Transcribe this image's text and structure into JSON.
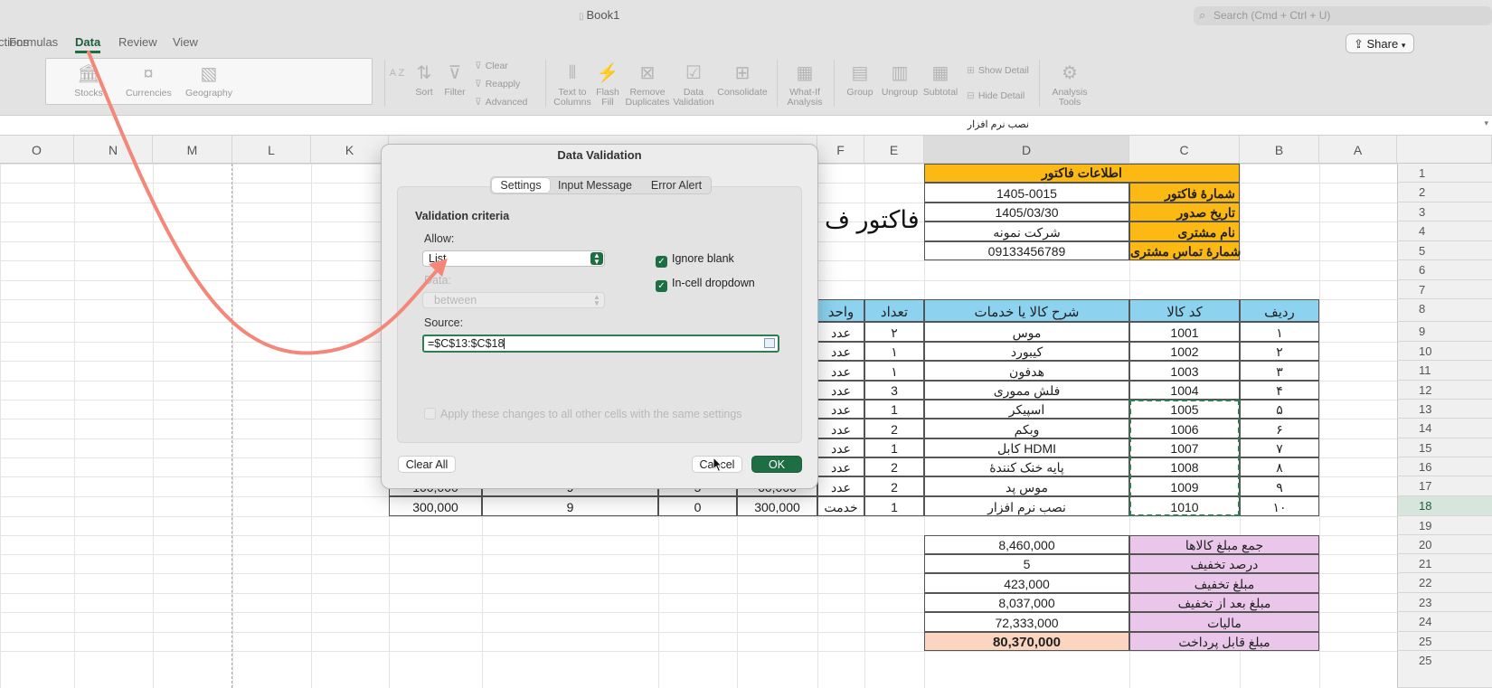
{
  "window": {
    "doc_title": "Book1",
    "search_placeholder": "Search (Cmd + Ctrl + U)",
    "share_label": "Share"
  },
  "menu": {
    "tabs": [
      {
        "label": "ctions"
      },
      {
        "label": "Formulas"
      },
      {
        "label": "Data"
      },
      {
        "label": "Review"
      },
      {
        "label": "View"
      }
    ]
  },
  "ribbon": {
    "data_types": [
      "Stocks",
      "Currencies",
      "Geography"
    ],
    "sort_az": "A Z",
    "sort": "Sort",
    "filter": "Filter",
    "clear": "Clear",
    "reapply": "Reapply",
    "advanced": "Advanced",
    "text_to_columns": [
      "Text to",
      "Columns"
    ],
    "flash_fill": [
      "Flash",
      "Fill"
    ],
    "remove_duplicates": [
      "Remove",
      "Duplicates"
    ],
    "data_validation": [
      "Data",
      "Validation"
    ],
    "consolidate": "Consolidate",
    "what_if": [
      "What-If",
      "Analysis"
    ],
    "group": "Group",
    "ungroup": "Ungroup",
    "subtotal": "Subtotal",
    "show_detail": "Show Detail",
    "hide_detail": "Hide Detail",
    "analysis_tools": [
      "Analysis",
      "Tools"
    ]
  },
  "formula_bar": {
    "content": "نصب نرم افزار"
  },
  "columns": [
    "O",
    "N",
    "M",
    "L",
    "K",
    "F",
    "E",
    "D",
    "C",
    "B",
    "A"
  ],
  "rows": [
    "1",
    "2",
    "3",
    "4",
    "5",
    "6",
    "7",
    "8",
    "9",
    "10",
    "11",
    "12",
    "13",
    "14",
    "15",
    "16",
    "17",
    "18",
    "19",
    "20",
    "21",
    "22",
    "23",
    "24",
    "25"
  ],
  "sheet": {
    "title_fragment": "فاکتور ف",
    "invoice_header": "اطلاعات فاکتور",
    "info": [
      {
        "label": "شمارهٔ فاکتور",
        "value": "1405-0015"
      },
      {
        "label": "تاریخ صدور",
        "value": "1405/03/30"
      },
      {
        "label": "نام مشتری",
        "value": "شرکت نمونه"
      },
      {
        "label": "شمارهٔ تماس مشتری",
        "value": "09133456789"
      }
    ],
    "table_headers": {
      "row_no": "ردیف",
      "code": "کد کالا",
      "desc": "شرح کالا یا خدمات",
      "qty": "تعداد",
      "unit": "واحد"
    },
    "items": [
      {
        "no": "۱",
        "code": "1001",
        "desc": "موس",
        "qty": "۲",
        "unit": "عدد"
      },
      {
        "no": "۲",
        "code": "1002",
        "desc": "کیبورد",
        "qty": "۱",
        "unit": "عدد"
      },
      {
        "no": "۳",
        "code": "1003",
        "desc": "هدفون",
        "qty": "۱",
        "unit": "عدد"
      },
      {
        "no": "۴",
        "code": "1004",
        "desc": "فلش مموری",
        "qty": "3",
        "unit": "عدد"
      },
      {
        "no": "۵",
        "code": "1005",
        "desc": "اسپیکر",
        "qty": "1",
        "unit": "عدد"
      },
      {
        "no": "۶",
        "code": "1006",
        "desc": "وبکم",
        "qty": "2",
        "unit": "عدد"
      },
      {
        "no": "۷",
        "code": "1007",
        "desc": "کابل HDMI",
        "qty": "1",
        "unit": "عدد"
      },
      {
        "no": "۸",
        "code": "1008",
        "desc": "پایه خنک کنندهٔ",
        "qty": "2",
        "unit": "عدد"
      },
      {
        "no": "۹",
        "code": "1009",
        "desc": "موس پد",
        "qty": "2",
        "unit": "عدد"
      },
      {
        "no": "۱۰",
        "code": "1010",
        "desc": "نصب نرم افزار",
        "qty": "1",
        "unit": "خدمت"
      }
    ],
    "row17_left": [
      "100,000",
      "9",
      "5",
      "60,000"
    ],
    "row18_left": [
      "300,000",
      "9",
      "0",
      "300,000"
    ],
    "totals": [
      {
        "label": "جمع مبلغ کالاها",
        "value": "8,460,000"
      },
      {
        "label": "درصد تخفیف",
        "value": "5"
      },
      {
        "label": "مبلغ تخفیف",
        "value": "423,000"
      },
      {
        "label": "مبلغ بعد از تخفیف",
        "value": "8,037,000"
      },
      {
        "label": "مالیات",
        "value": "72,333,000"
      },
      {
        "label": "مبلغ قابل پرداخت",
        "value": "80,370,000"
      }
    ]
  },
  "dialog": {
    "title": "Data Validation",
    "tabs": [
      "Settings",
      "Input Message",
      "Error Alert"
    ],
    "criteria_heading": "Validation criteria",
    "allow_label": "Allow:",
    "allow_value": "List",
    "data_label": "Data:",
    "data_value": "between",
    "ignore_blank": "Ignore blank",
    "in_cell_dropdown": "In-cell dropdown",
    "source_label": "Source:",
    "source_value": "=$C$13:$C$18",
    "apply_all": "Apply these changes to all other cells with the same settings",
    "clear_all": "Clear All",
    "cancel": "Cancel",
    "ok": "OK"
  },
  "colors": {
    "accent": "#1d6e42",
    "header_orange": "#fdb913",
    "table_header_blue": "#8dd3f0",
    "totals_pink": "#eac7ea",
    "grand_total": "#fbd5bf",
    "annotation_arrow": "#f4877a"
  }
}
